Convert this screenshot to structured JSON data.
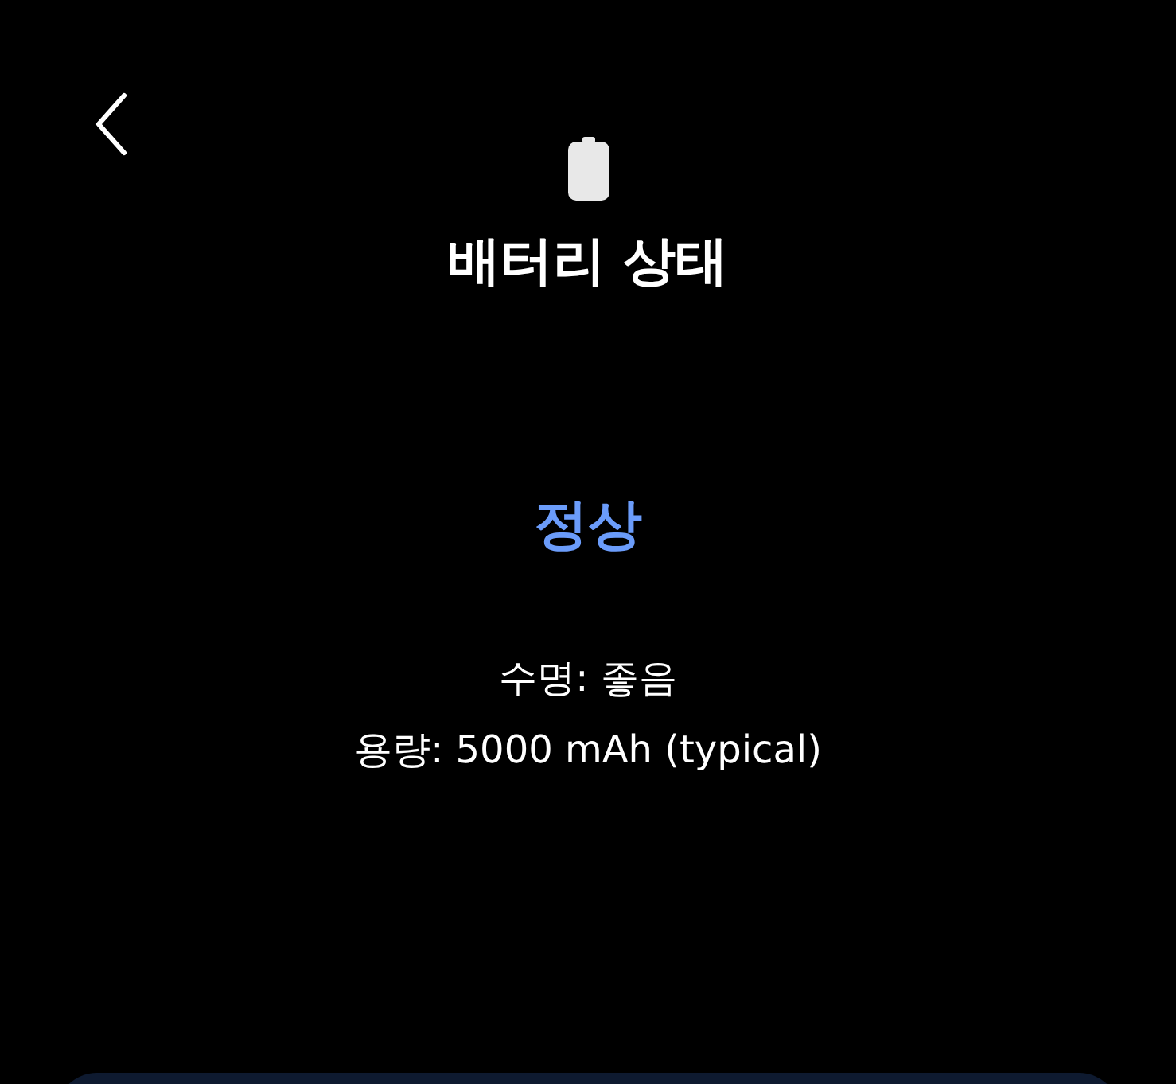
{
  "title": "배터리 상태",
  "status": {
    "label": "정상",
    "color": "#6b9cfa"
  },
  "details": [
    {
      "label": "수명: 좋음"
    },
    {
      "label": "용량: 5000 mAh (typical)"
    }
  ]
}
